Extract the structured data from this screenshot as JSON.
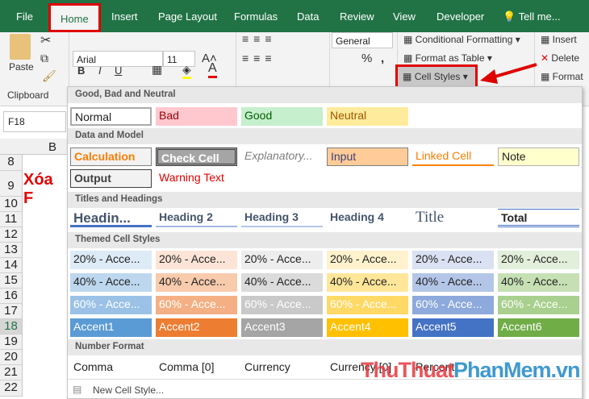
{
  "tabs": [
    "File",
    "Home",
    "Insert",
    "Page Layout",
    "Formulas",
    "Data",
    "Review",
    "View",
    "Developer",
    "Tell me..."
  ],
  "ribbon": {
    "paste": "Paste",
    "font": "Arial",
    "size": "11",
    "bold": "B",
    "italic": "I",
    "underline": "U",
    "number_format": "General",
    "percent": "%",
    "comma": ",",
    "conditional_formatting": "Conditional Formatting",
    "format_as_table": "Format as Table",
    "cell_styles": "Cell Styles",
    "insert": "Insert",
    "delete": "Delete",
    "format": "Format",
    "clipboard_label": "Clipboard"
  },
  "sheet": {
    "name_box": "F18",
    "column": "B",
    "rows": [
      "8",
      "9",
      "10",
      "11",
      "12",
      "13",
      "14",
      "15",
      "16",
      "17",
      "18",
      "19",
      "20",
      "21",
      "22"
    ],
    "cell_text": "Xóa F"
  },
  "gallery": {
    "sections": [
      {
        "title": "Good, Bad and Neutral",
        "rows": [
          [
            {
              "t": "Normal",
              "s": "normal"
            },
            {
              "t": "Bad",
              "s": "bad"
            },
            {
              "t": "Good",
              "s": "good"
            },
            {
              "t": "Neutral",
              "s": "neutral"
            }
          ]
        ]
      },
      {
        "title": "Data and Model",
        "rows": [
          [
            {
              "t": "Calculation",
              "s": "calc"
            },
            {
              "t": "Check Cell",
              "s": "check"
            },
            {
              "t": "Explanatory...",
              "s": "expl"
            },
            {
              "t": "Input",
              "s": "input"
            },
            {
              "t": "Linked Cell",
              "s": "linked"
            },
            {
              "t": "Note",
              "s": "note"
            }
          ],
          [
            {
              "t": "Output",
              "s": "output"
            },
            {
              "t": "Warning Text",
              "s": "warn"
            }
          ]
        ]
      },
      {
        "title": "Titles and Headings",
        "rows": [
          [
            {
              "t": "Headin...",
              "s": "h1"
            },
            {
              "t": "Heading 2",
              "s": "h2"
            },
            {
              "t": "Heading 3",
              "s": "h3"
            },
            {
              "t": "Heading 4",
              "s": "h4"
            },
            {
              "t": "Title",
              "s": "title"
            },
            {
              "t": "Total",
              "s": "total"
            }
          ]
        ]
      },
      {
        "title": "Themed Cell Styles",
        "rows": [
          [
            {
              "t": "20% - Acce...",
              "bg": "#ddebf7"
            },
            {
              "t": "20% - Acce...",
              "bg": "#fce4d6"
            },
            {
              "t": "20% - Acce...",
              "bg": "#ededed"
            },
            {
              "t": "20% - Acce...",
              "bg": "#fff2cc"
            },
            {
              "t": "20% - Acce...",
              "bg": "#d9e1f2"
            },
            {
              "t": "20% - Acce...",
              "bg": "#e2efda"
            }
          ],
          [
            {
              "t": "40% - Acce...",
              "bg": "#bdd7ee"
            },
            {
              "t": "40% - Acce...",
              "bg": "#f8cbad"
            },
            {
              "t": "40% - Acce...",
              "bg": "#dbdbdb"
            },
            {
              "t": "40% - Acce...",
              "bg": "#ffe699"
            },
            {
              "t": "40% - Acce...",
              "bg": "#b4c6e7"
            },
            {
              "t": "40% - Acce...",
              "bg": "#c6e0b4"
            }
          ],
          [
            {
              "t": "60% - Acce...",
              "bg": "#9bc2e6",
              "fg": "#fff"
            },
            {
              "t": "60% - Acce...",
              "bg": "#f4b084",
              "fg": "#fff"
            },
            {
              "t": "60% - Acce...",
              "bg": "#c9c9c9",
              "fg": "#fff"
            },
            {
              "t": "60% - Acce...",
              "bg": "#ffd966",
              "fg": "#fff"
            },
            {
              "t": "60% - Acce...",
              "bg": "#8ea9db",
              "fg": "#fff"
            },
            {
              "t": "60% - Acce...",
              "bg": "#a9d08e",
              "fg": "#fff"
            }
          ],
          [
            {
              "t": "Accent1",
              "bg": "#5b9bd5",
              "fg": "#fff"
            },
            {
              "t": "Accent2",
              "bg": "#ed7d31",
              "fg": "#fff"
            },
            {
              "t": "Accent3",
              "bg": "#a5a5a5",
              "fg": "#fff"
            },
            {
              "t": "Accent4",
              "bg": "#ffc000",
              "fg": "#fff"
            },
            {
              "t": "Accent5",
              "bg": "#4472c4",
              "fg": "#fff"
            },
            {
              "t": "Accent6",
              "bg": "#70ad47",
              "fg": "#fff"
            }
          ]
        ]
      },
      {
        "title": "Number Format",
        "rows": [
          [
            {
              "t": "Comma"
            },
            {
              "t": "Comma [0]"
            },
            {
              "t": "Currency"
            },
            {
              "t": "Currency [0]"
            },
            {
              "t": "Percent"
            }
          ]
        ]
      }
    ],
    "new_cell_style": "New Cell Style..."
  },
  "watermark": {
    "part1": "ThuThuat",
    "part2": "PhanMem.vn"
  },
  "colors": {
    "excel_green": "#217346",
    "highlight": "#e00000"
  }
}
